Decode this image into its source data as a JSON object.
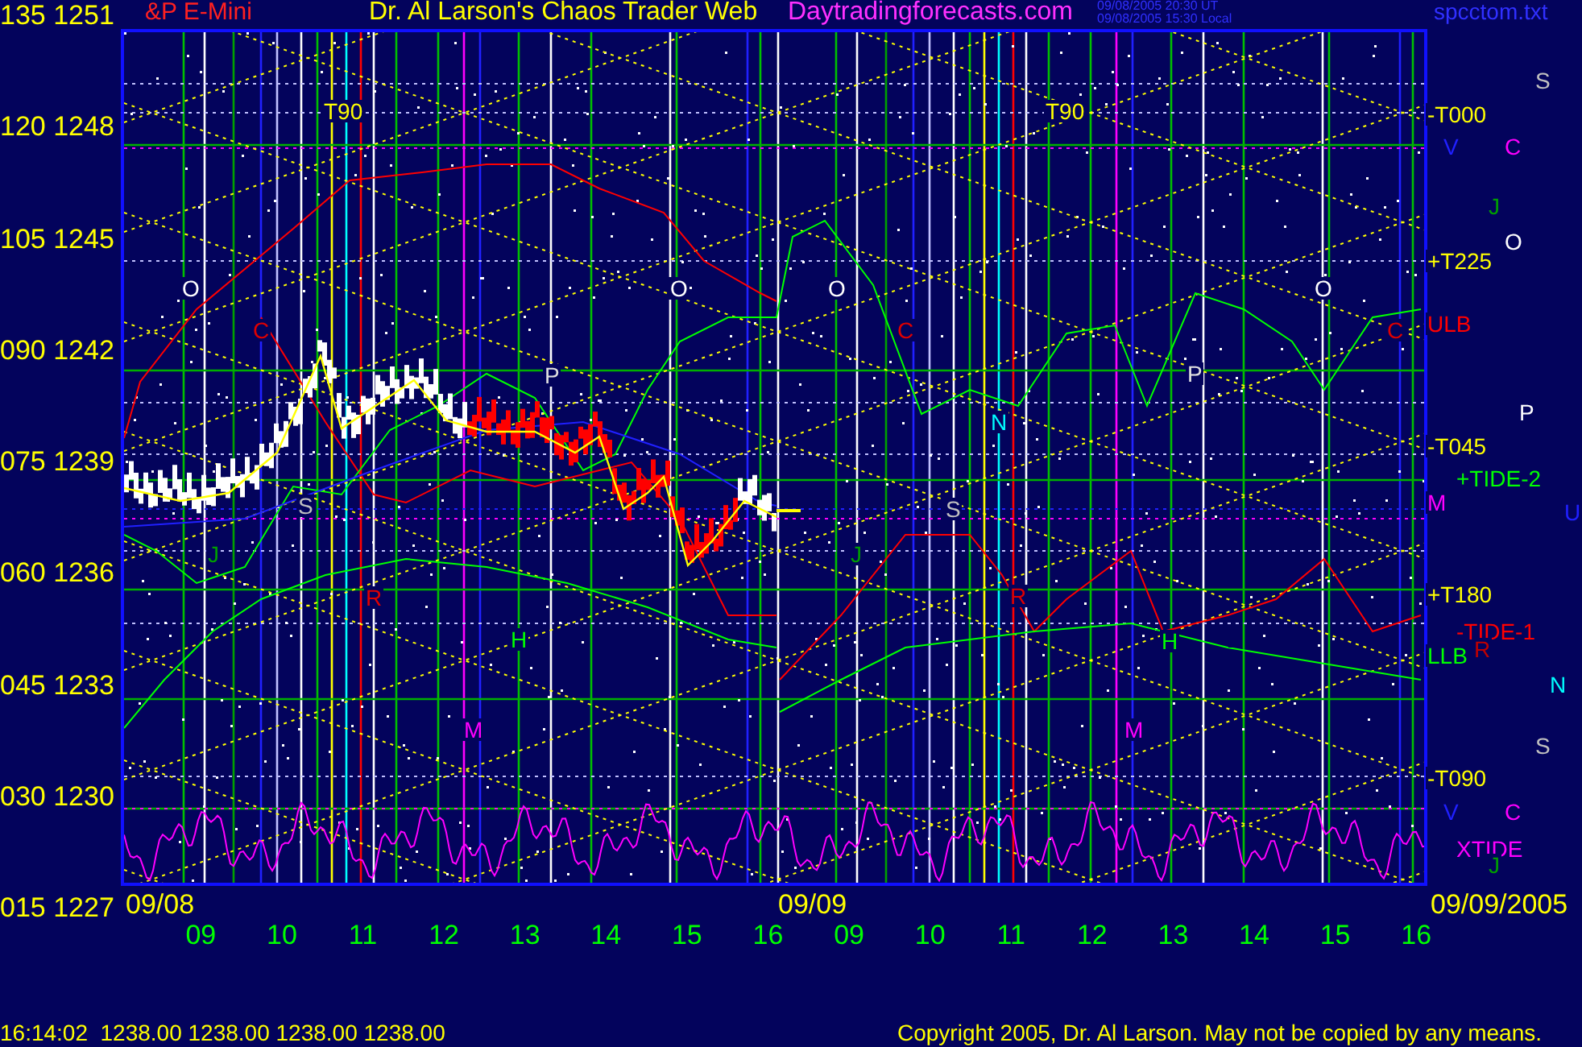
{
  "header": {
    "symbol": "&P E-Mini",
    "title": "Dr. Al Larson's Chaos Trader Web",
    "site": "Daytradingforecasts.com",
    "timestamps": [
      "09/08/2005 20:30 UT",
      "09/08/2005 15:30 Local"
    ],
    "file": "spcctom.txt"
  },
  "y_axis_labels": [
    "135 1251",
    "120 1248",
    "105 1245",
    "090 1242",
    "075 1239",
    "060 1236",
    "045 1233",
    "030 1230",
    "015 1227"
  ],
  "chart_labels": [
    {
      "text": "T90",
      "color": "#ffff00"
    },
    {
      "text": "O",
      "color": "#ffffff"
    },
    {
      "text": "C",
      "color": "#e00000"
    },
    {
      "text": "S",
      "color": "#c0c0c0"
    },
    {
      "text": "J",
      "color": "#00a000"
    },
    {
      "text": "R",
      "color": "#e00000"
    },
    {
      "text": "H",
      "color": "#00ff00"
    },
    {
      "text": "M",
      "color": "#ff00ff"
    },
    {
      "text": "P",
      "color": "#e0e0e0"
    },
    {
      "text": "O",
      "color": "#ffffff"
    },
    {
      "text": "O",
      "color": "#ffffff"
    },
    {
      "text": "C",
      "color": "#e00000"
    },
    {
      "text": "N",
      "color": "#00ffff"
    },
    {
      "text": "S",
      "color": "#c0c0c0"
    },
    {
      "text": "J",
      "color": "#00a000"
    },
    {
      "text": "R",
      "color": "#e00000"
    },
    {
      "text": "H",
      "color": "#00ff00"
    },
    {
      "text": "M",
      "color": "#ff00ff"
    },
    {
      "text": "T90",
      "color": "#ffff00"
    },
    {
      "text": "P",
      "color": "#e0e0e0"
    },
    {
      "text": "O",
      "color": "#ffffff"
    },
    {
      "text": "C",
      "color": "#e00000"
    }
  ],
  "right_labels": [
    {
      "text": "S",
      "color": "#c0c0c0"
    },
    {
      "text": "-T000",
      "color": "#ffff00"
    },
    {
      "text": "V",
      "color": "#2020ff"
    },
    {
      "text": "C",
      "color": "#ff00ff"
    },
    {
      "text": "J",
      "color": "#00a000"
    },
    {
      "text": "O",
      "color": "#ffffff"
    },
    {
      "text": "+T225",
      "color": "#ffff00"
    },
    {
      "text": "ULB",
      "color": "#ff0000"
    },
    {
      "text": "P",
      "color": "#ffffff"
    },
    {
      "text": "-T045",
      "color": "#ffff00"
    },
    {
      "text": "+TIDE-2",
      "color": "#00ff00"
    },
    {
      "text": "M",
      "color": "#ff00ff"
    },
    {
      "text": "U",
      "color": "#2020ff"
    },
    {
      "text": "+T180",
      "color": "#ffff00"
    },
    {
      "text": "-TIDE-1",
      "color": "#ff0000"
    },
    {
      "text": "R",
      "color": "#c00000"
    },
    {
      "text": "LLB",
      "color": "#00ff00"
    },
    {
      "text": "N",
      "color": "#00ffff"
    },
    {
      "text": "S",
      "color": "#c0c0c0"
    },
    {
      "text": "-T090",
      "color": "#ffff00"
    },
    {
      "text": "V",
      "color": "#2020ff"
    },
    {
      "text": "C",
      "color": "#ff00ff"
    },
    {
      "text": "XTIDE",
      "color": "#ff00ff"
    },
    {
      "text": "J",
      "color": "#00a000"
    }
  ],
  "date_labels": [
    "09/08",
    "09/09",
    "09/09/2005"
  ],
  "x_axis_labels": [
    "09",
    "10",
    "11",
    "12",
    "13",
    "14",
    "15",
    "16",
    "09",
    "10",
    "11",
    "12",
    "13",
    "14",
    "15",
    "16"
  ],
  "footer": {
    "quote": "16:14:02  1238.00 1238.00 1238.00 1238.00",
    "copyright": "Copyright 2005, Dr. Al Larson. May not be copied by any means."
  }
}
